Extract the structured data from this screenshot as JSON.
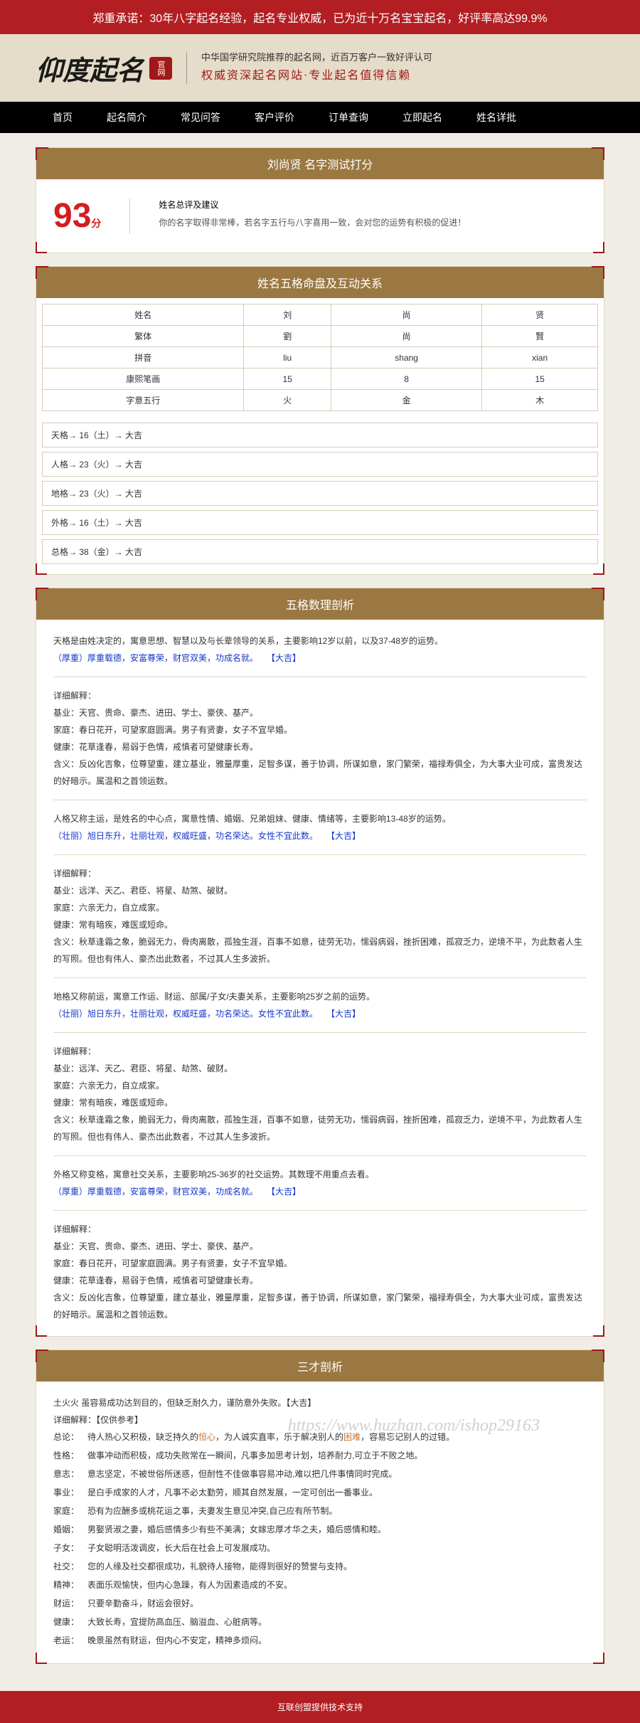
{
  "banner": "郑重承诺：30年八字起名经验，起名专业权威，已为近十万名宝宝起名，好评率高达99.9%",
  "logo": {
    "text": "仰度起名",
    "seal": "官网"
  },
  "header": {
    "line1": "中华国学研究院推荐的起名网，近百万客户一致好评认可",
    "line2": "权威资深起名网站·专业起名值得信赖"
  },
  "nav": [
    "首页",
    "起名简介",
    "常见问答",
    "客户评价",
    "订单查询",
    "立即起名",
    "姓名详批"
  ],
  "score_card": {
    "title": "刘尚贤 名字测试打分",
    "score": "93",
    "unit": "分",
    "heading": "姓名总评及建议",
    "text": "你的名字取得非常棒，若名字五行与八字喜用一致，会对您的运势有积极的促进！"
  },
  "wuge": {
    "title": "姓名五格命盘及互动关系",
    "rows": [
      [
        "姓名",
        "刘",
        "尚",
        "贤"
      ],
      [
        "繁体",
        "劉",
        "尚",
        "賢"
      ],
      [
        "拼音",
        "liu",
        "shang",
        "xian"
      ],
      [
        "康熙笔画",
        "15",
        "8",
        "15"
      ],
      [
        "字意五行",
        "火",
        "金",
        "木"
      ]
    ],
    "grids": [
      "天格→ 16（土）→ 大吉",
      "人格→ 23（火）→ 大吉",
      "地格→ 23（火）→ 大吉",
      "外格→ 16（土）→ 大吉",
      "总格→ 38（金）→ 大吉"
    ]
  },
  "shuli": {
    "title": "五格数理剖析",
    "sections": [
      {
        "intro": "天格是由姓决定的，寓意思想、智慧以及与长辈领导的关系，主要影响12岁以前，以及37-48岁的运势。",
        "blue": "（厚重）厚重载德，安富尊荣，财官双美，功成名就。",
        "tag": "【大吉】",
        "label": "详细解释：",
        "lines": [
          "基业：天官、贵命、豪杰、进田、学士、豪侠、基产。",
          "家庭：春日花开，可望家庭圆满。男子有贤妻，女子不宜早婚。",
          "健康：花草逢春，易弱于色情，戒慎者可望健康长寿。",
          "含义：反凶化吉象，位尊望重，建立基业，雅量厚重，足智多谋，善于协调，所谋如意，家门繁荣，福禄寿俱全，为大事大业可成，富贵发达的好暗示。属温和之首领运数。"
        ]
      },
      {
        "intro": "人格又称主运，是姓名的中心点，寓意性情、婚姻、兄弟姐妹、健康、情绪等，主要影响13-48岁的运势。",
        "blue": "（壮丽）旭日东升，壮丽壮观，权威旺盛，功名荣达。女性不宜此数。",
        "tag": "【大吉】",
        "label": "详细解释：",
        "lines": [
          "基业：远洋、天乙、君臣、将星、劫煞、破财。",
          "家庭：六亲无力，自立成家。",
          "健康：常有暗疾，难医或短命。",
          "含义：秋草逢霜之象，脆弱无力，骨肉离散，孤独生涯，百事不如意，徒劳无功，懦弱病弱，挫折困难，孤寂乏力，逆境不平，为此数者人生的写照。但也有伟人、豪杰出此数者，不过其人生多波折。"
        ]
      },
      {
        "intro": "地格又称前运，寓意工作运、财运、部属/子女/夫妻关系，主要影响25岁之前的运势。",
        "blue": "（壮丽）旭日东升，壮丽壮观，权威旺盛，功名荣达。女性不宜此数。",
        "tag": "【大吉】",
        "label": "详细解释：",
        "lines": [
          "基业：远洋、天乙、君臣、将星、劫煞、破财。",
          "家庭：六亲无力，自立成家。",
          "健康：常有暗疾，难医或短命。",
          "含义：秋草逢霜之象，脆弱无力，骨肉离散，孤独生涯，百事不如意，徒劳无功，懦弱病弱，挫折困难，孤寂乏力，逆境不平，为此数者人生的写照。但也有伟人、豪杰出此数者，不过其人生多波折。"
        ]
      },
      {
        "intro": "外格又称变格，寓意社交关系，主要影响25-36岁的社交运势。其数理不用重点去看。",
        "blue": "（厚重）厚重载德，安富尊荣，财官双美，功成名就。",
        "tag": "【大吉】",
        "label": "详细解释：",
        "lines": [
          "基业：天官、贵命、豪杰、进田、学士、豪侠、基产。",
          "家庭：春日花开，可望家庭圆满。男子有贤妻，女子不宜早婚。",
          "健康：花草逢春，易弱于色情，戒慎者可望健康长寿。",
          "含义：反凶化吉象，位尊望重，建立基业，雅量厚重，足智多谋，善于协调，所谋如意，家门繁荣，福禄寿俱全，为大事大业可成，富贵发达的好暗示。属温和之首领运数。"
        ]
      }
    ]
  },
  "sancai": {
    "title": "三才剖析",
    "summary": "土火火 虽容易成功达到目的，但缺乏耐久力，谨防意外失败。【大吉】",
    "detail_label": "详细解释：【仅供参考】",
    "rows": [
      {
        "label": "总论：",
        "text": "待人热心又积极，缺乏持久的",
        "orange": "恒心",
        "text2": "，为人诚实直率，乐于解决别人的",
        "orange2": "困难",
        "text3": "，容易忘记别人的过错。"
      },
      {
        "label": "性格：",
        "text": "做事冲动而积极，成功失败常在一瞬间，凡事多加思考计划，培养耐力,可立于不败之地。"
      },
      {
        "label": "意志：",
        "text": "意志坚定，不被世俗所迷惑，但耐性不佳做事容易冲动,难以把几件事情同时完成。"
      },
      {
        "label": "事业：",
        "text": "是白手成家的人才，凡事不必太勤劳，顺其自然发展，一定可创出一番事业。"
      },
      {
        "label": "家庭：",
        "text": "恐有为应酬多或桃花运之事，夫妻发生意见冲突,自己应有所节制。"
      },
      {
        "label": "婚姻：",
        "text": "男娶贤淑之妻，婚后感情多少有些不美满；女嫁忠厚才华之夫，婚后感情和睦。"
      },
      {
        "label": "子女：",
        "text": "子女聪明活泼调皮，长大后在社会上可发展成功。"
      },
      {
        "label": "社交：",
        "text": "您的人缘及社交都很成功，礼貌待人接物，能得到很好的赞誉与支持。"
      },
      {
        "label": "精神：",
        "text": "表面乐观愉快，但内心急躁，有人为因素造成的不安。"
      },
      {
        "label": "财运：",
        "text": "只要辛勤奋斗，财运会很好。"
      },
      {
        "label": "健康：",
        "text": "大致长寿，宜提防高血压、脑溢血、心脏病等。"
      },
      {
        "label": "老运：",
        "text": "晚景虽然有财运，但内心不安定，精神多烦闷。"
      }
    ]
  },
  "footer": "互联创盟提供技术支持",
  "watermark": "https://www.huzhan.com/ishop29163"
}
